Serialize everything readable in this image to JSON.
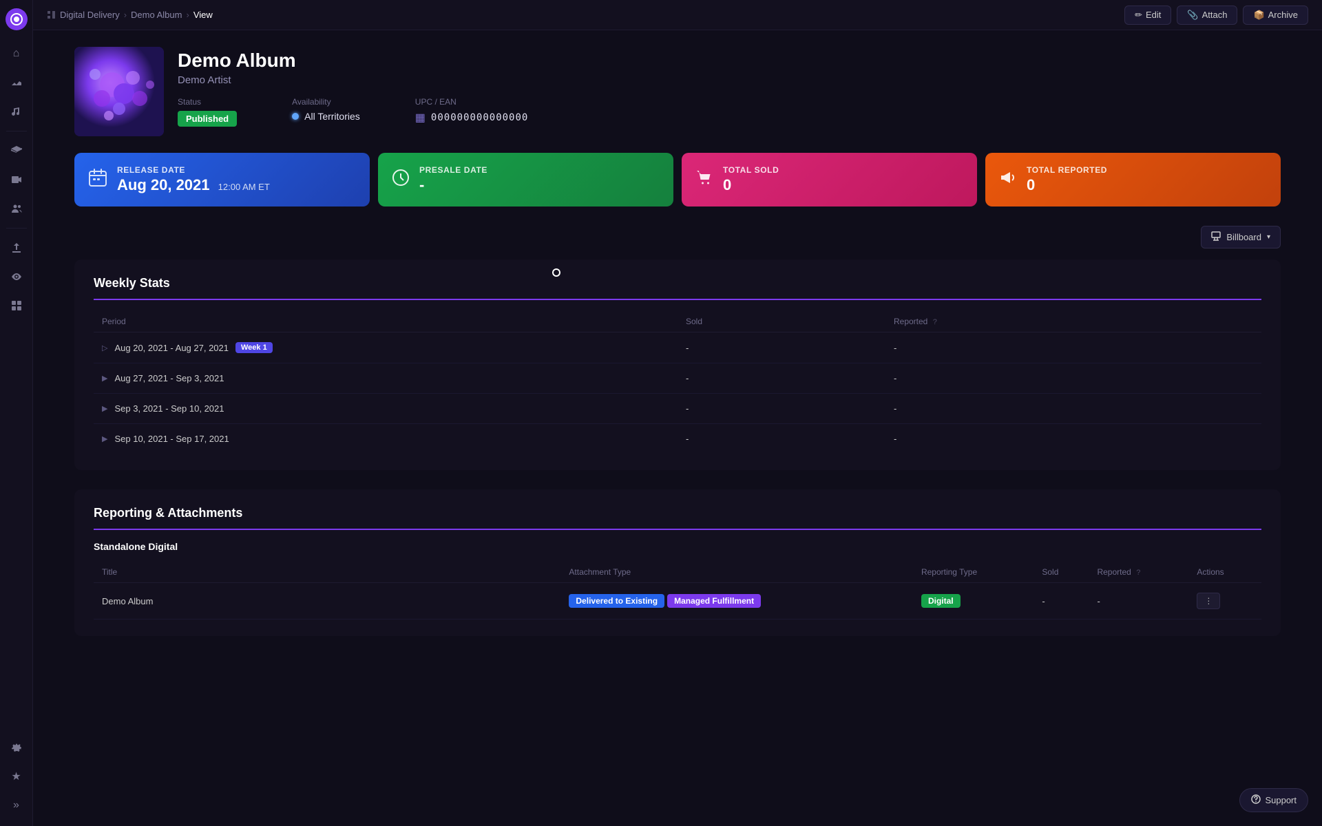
{
  "app": {
    "logo_icon": "●"
  },
  "sidebar": {
    "icons": [
      {
        "name": "home-icon",
        "glyph": "⌂",
        "active": false
      },
      {
        "name": "chart-icon",
        "glyph": "↗",
        "active": false
      },
      {
        "name": "music-icon",
        "glyph": "♪",
        "active": false
      },
      {
        "name": "layers-icon",
        "glyph": "▤",
        "active": false
      },
      {
        "name": "video-icon",
        "glyph": "▶",
        "active": false
      },
      {
        "name": "people-icon",
        "glyph": "👥",
        "active": false
      },
      {
        "name": "upload-icon",
        "glyph": "↑",
        "active": false
      },
      {
        "name": "eye-icon",
        "glyph": "◉",
        "active": false
      },
      {
        "name": "grid-icon",
        "glyph": "⊞",
        "active": false
      }
    ],
    "bottom_icons": [
      {
        "name": "settings-icon",
        "glyph": "⚙"
      },
      {
        "name": "star-icon",
        "glyph": "★"
      },
      {
        "name": "expand-icon",
        "glyph": "»"
      }
    ]
  },
  "topbar": {
    "breadcrumb": {
      "root": "Digital Delivery",
      "parent": "Demo Album",
      "current": "View"
    },
    "actions": [
      {
        "name": "edit-button",
        "label": "Edit",
        "icon": "✏"
      },
      {
        "name": "attach-button",
        "label": "Attach",
        "icon": "📎"
      },
      {
        "name": "archive-button",
        "label": "Archive",
        "icon": "📦"
      }
    ]
  },
  "album": {
    "title": "Demo Album",
    "artist": "Demo Artist",
    "status_label": "Published",
    "availability_label": "Availability",
    "availability_value": "All Territories",
    "upc_label": "UPC / EAN",
    "upc_value": "000000000000000"
  },
  "stat_cards": [
    {
      "name": "release-date-card",
      "label": "Release Date",
      "value": "Aug 20, 2021",
      "sub": "12:00 AM ET",
      "icon": "📅",
      "style": "release"
    },
    {
      "name": "presale-date-card",
      "label": "Presale Date",
      "value": "-",
      "sub": "",
      "icon": "🕐",
      "style": "presale"
    },
    {
      "name": "total-sold-card",
      "label": "Total Sold",
      "value": "0",
      "sub": "",
      "icon": "🛒",
      "style": "total-sold"
    },
    {
      "name": "total-reported-card",
      "label": "Total Reported",
      "value": "0",
      "sub": "",
      "icon": "📣",
      "style": "total-reported"
    }
  ],
  "billboard": {
    "label": "Billboard",
    "icon": "📋"
  },
  "weekly_stats": {
    "title": "Weekly Stats",
    "columns": [
      "Period",
      "Sold",
      "Reported"
    ],
    "rows": [
      {
        "period": "Aug 20, 2021 - Aug 27, 2021",
        "week_badge": "Week 1",
        "sold": "-",
        "reported": "-",
        "expandable": false
      },
      {
        "period": "Aug 27, 2021 - Sep 3, 2021",
        "week_badge": "",
        "sold": "-",
        "reported": "-",
        "expandable": true
      },
      {
        "period": "Sep 3, 2021 - Sep 10, 2021",
        "week_badge": "",
        "sold": "-",
        "reported": "-",
        "expandable": true
      },
      {
        "period": "Sep 10, 2021 - Sep 17, 2021",
        "week_badge": "",
        "sold": "-",
        "reported": "-",
        "expandable": true
      }
    ]
  },
  "reporting": {
    "title": "Reporting & Attachments",
    "sub_title": "Standalone Digital",
    "columns": [
      "Title",
      "Attachment Type",
      "Reporting Type",
      "Sold",
      "Reported",
      "Actions"
    ],
    "rows": [
      {
        "title": "Demo Album",
        "attachment_tags": [
          "Delivered to Existing",
          "Managed Fulfillment"
        ],
        "reporting_tag": "Digital",
        "attachment_type_tag": "Digital",
        "sold": "-",
        "reported": "-",
        "has_action": true
      }
    ]
  },
  "support": {
    "label": "Support"
  }
}
